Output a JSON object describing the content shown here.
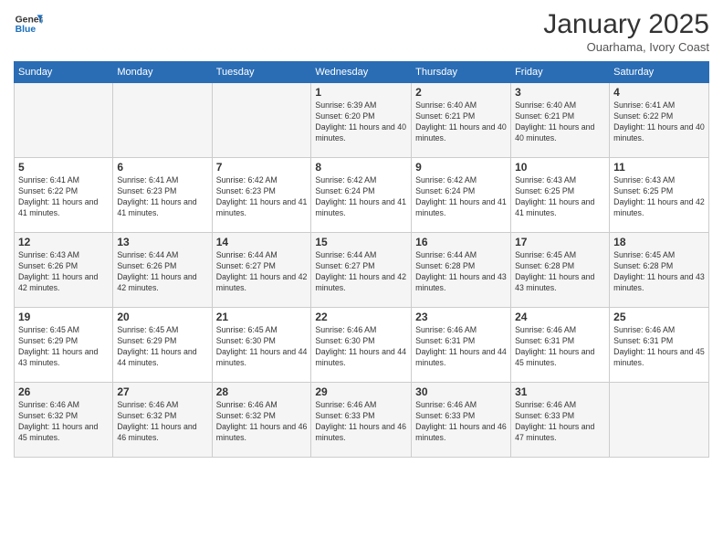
{
  "header": {
    "logo_line1": "General",
    "logo_line2": "Blue",
    "month": "January 2025",
    "location": "Ouarhama, Ivory Coast"
  },
  "days_of_week": [
    "Sunday",
    "Monday",
    "Tuesday",
    "Wednesday",
    "Thursday",
    "Friday",
    "Saturday"
  ],
  "weeks": [
    [
      {
        "day": "",
        "sunrise": "",
        "sunset": "",
        "daylight": ""
      },
      {
        "day": "",
        "sunrise": "",
        "sunset": "",
        "daylight": ""
      },
      {
        "day": "",
        "sunrise": "",
        "sunset": "",
        "daylight": ""
      },
      {
        "day": "1",
        "sunrise": "Sunrise: 6:39 AM",
        "sunset": "Sunset: 6:20 PM",
        "daylight": "Daylight: 11 hours and 40 minutes."
      },
      {
        "day": "2",
        "sunrise": "Sunrise: 6:40 AM",
        "sunset": "Sunset: 6:21 PM",
        "daylight": "Daylight: 11 hours and 40 minutes."
      },
      {
        "day": "3",
        "sunrise": "Sunrise: 6:40 AM",
        "sunset": "Sunset: 6:21 PM",
        "daylight": "Daylight: 11 hours and 40 minutes."
      },
      {
        "day": "4",
        "sunrise": "Sunrise: 6:41 AM",
        "sunset": "Sunset: 6:22 PM",
        "daylight": "Daylight: 11 hours and 40 minutes."
      }
    ],
    [
      {
        "day": "5",
        "sunrise": "Sunrise: 6:41 AM",
        "sunset": "Sunset: 6:22 PM",
        "daylight": "Daylight: 11 hours and 41 minutes."
      },
      {
        "day": "6",
        "sunrise": "Sunrise: 6:41 AM",
        "sunset": "Sunset: 6:23 PM",
        "daylight": "Daylight: 11 hours and 41 minutes."
      },
      {
        "day": "7",
        "sunrise": "Sunrise: 6:42 AM",
        "sunset": "Sunset: 6:23 PM",
        "daylight": "Daylight: 11 hours and 41 minutes."
      },
      {
        "day": "8",
        "sunrise": "Sunrise: 6:42 AM",
        "sunset": "Sunset: 6:24 PM",
        "daylight": "Daylight: 11 hours and 41 minutes."
      },
      {
        "day": "9",
        "sunrise": "Sunrise: 6:42 AM",
        "sunset": "Sunset: 6:24 PM",
        "daylight": "Daylight: 11 hours and 41 minutes."
      },
      {
        "day": "10",
        "sunrise": "Sunrise: 6:43 AM",
        "sunset": "Sunset: 6:25 PM",
        "daylight": "Daylight: 11 hours and 41 minutes."
      },
      {
        "day": "11",
        "sunrise": "Sunrise: 6:43 AM",
        "sunset": "Sunset: 6:25 PM",
        "daylight": "Daylight: 11 hours and 42 minutes."
      }
    ],
    [
      {
        "day": "12",
        "sunrise": "Sunrise: 6:43 AM",
        "sunset": "Sunset: 6:26 PM",
        "daylight": "Daylight: 11 hours and 42 minutes."
      },
      {
        "day": "13",
        "sunrise": "Sunrise: 6:44 AM",
        "sunset": "Sunset: 6:26 PM",
        "daylight": "Daylight: 11 hours and 42 minutes."
      },
      {
        "day": "14",
        "sunrise": "Sunrise: 6:44 AM",
        "sunset": "Sunset: 6:27 PM",
        "daylight": "Daylight: 11 hours and 42 minutes."
      },
      {
        "day": "15",
        "sunrise": "Sunrise: 6:44 AM",
        "sunset": "Sunset: 6:27 PM",
        "daylight": "Daylight: 11 hours and 42 minutes."
      },
      {
        "day": "16",
        "sunrise": "Sunrise: 6:44 AM",
        "sunset": "Sunset: 6:28 PM",
        "daylight": "Daylight: 11 hours and 43 minutes."
      },
      {
        "day": "17",
        "sunrise": "Sunrise: 6:45 AM",
        "sunset": "Sunset: 6:28 PM",
        "daylight": "Daylight: 11 hours and 43 minutes."
      },
      {
        "day": "18",
        "sunrise": "Sunrise: 6:45 AM",
        "sunset": "Sunset: 6:28 PM",
        "daylight": "Daylight: 11 hours and 43 minutes."
      }
    ],
    [
      {
        "day": "19",
        "sunrise": "Sunrise: 6:45 AM",
        "sunset": "Sunset: 6:29 PM",
        "daylight": "Daylight: 11 hours and 43 minutes."
      },
      {
        "day": "20",
        "sunrise": "Sunrise: 6:45 AM",
        "sunset": "Sunset: 6:29 PM",
        "daylight": "Daylight: 11 hours and 44 minutes."
      },
      {
        "day": "21",
        "sunrise": "Sunrise: 6:45 AM",
        "sunset": "Sunset: 6:30 PM",
        "daylight": "Daylight: 11 hours and 44 minutes."
      },
      {
        "day": "22",
        "sunrise": "Sunrise: 6:46 AM",
        "sunset": "Sunset: 6:30 PM",
        "daylight": "Daylight: 11 hours and 44 minutes."
      },
      {
        "day": "23",
        "sunrise": "Sunrise: 6:46 AM",
        "sunset": "Sunset: 6:31 PM",
        "daylight": "Daylight: 11 hours and 44 minutes."
      },
      {
        "day": "24",
        "sunrise": "Sunrise: 6:46 AM",
        "sunset": "Sunset: 6:31 PM",
        "daylight": "Daylight: 11 hours and 45 minutes."
      },
      {
        "day": "25",
        "sunrise": "Sunrise: 6:46 AM",
        "sunset": "Sunset: 6:31 PM",
        "daylight": "Daylight: 11 hours and 45 minutes."
      }
    ],
    [
      {
        "day": "26",
        "sunrise": "Sunrise: 6:46 AM",
        "sunset": "Sunset: 6:32 PM",
        "daylight": "Daylight: 11 hours and 45 minutes."
      },
      {
        "day": "27",
        "sunrise": "Sunrise: 6:46 AM",
        "sunset": "Sunset: 6:32 PM",
        "daylight": "Daylight: 11 hours and 46 minutes."
      },
      {
        "day": "28",
        "sunrise": "Sunrise: 6:46 AM",
        "sunset": "Sunset: 6:32 PM",
        "daylight": "Daylight: 11 hours and 46 minutes."
      },
      {
        "day": "29",
        "sunrise": "Sunrise: 6:46 AM",
        "sunset": "Sunset: 6:33 PM",
        "daylight": "Daylight: 11 hours and 46 minutes."
      },
      {
        "day": "30",
        "sunrise": "Sunrise: 6:46 AM",
        "sunset": "Sunset: 6:33 PM",
        "daylight": "Daylight: 11 hours and 46 minutes."
      },
      {
        "day": "31",
        "sunrise": "Sunrise: 6:46 AM",
        "sunset": "Sunset: 6:33 PM",
        "daylight": "Daylight: 11 hours and 47 minutes."
      },
      {
        "day": "",
        "sunrise": "",
        "sunset": "",
        "daylight": ""
      }
    ]
  ]
}
